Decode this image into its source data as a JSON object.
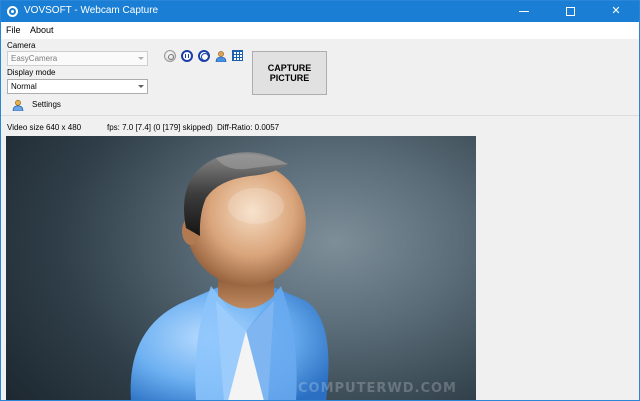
{
  "window": {
    "title": "VOVSOFT - Webcam Capture",
    "controls": {
      "minimize_icon": "minimize-icon",
      "maximize_icon": "maximize-icon",
      "close_glyph": "✕"
    }
  },
  "menu": {
    "items": [
      {
        "label": "File"
      },
      {
        "label": "About"
      }
    ]
  },
  "camera": {
    "label": "Camera",
    "selected": "EasyCamera"
  },
  "display_mode": {
    "label": "Display mode",
    "selected": "Normal"
  },
  "toolbar": {
    "icons": [
      "refresh-icon",
      "pause-icon",
      "stop-icon",
      "user-icon",
      "grid-icon"
    ]
  },
  "capture": {
    "label": "CAPTURE PICTURE"
  },
  "settings": {
    "label": "Settings",
    "icon": "user-settings-icon"
  },
  "status": {
    "video_size": "Video size 640 x 480",
    "fps": "fps: 7.0 [7.4] (0 [179] skipped)",
    "diff_ratio": "Diff-Ratio: 0.0057"
  },
  "video": {
    "watermark": "COMPUTERWD.COM"
  },
  "colors": {
    "titlebar": "#1a7fd4",
    "accent_blue": "#1b3fa8"
  }
}
